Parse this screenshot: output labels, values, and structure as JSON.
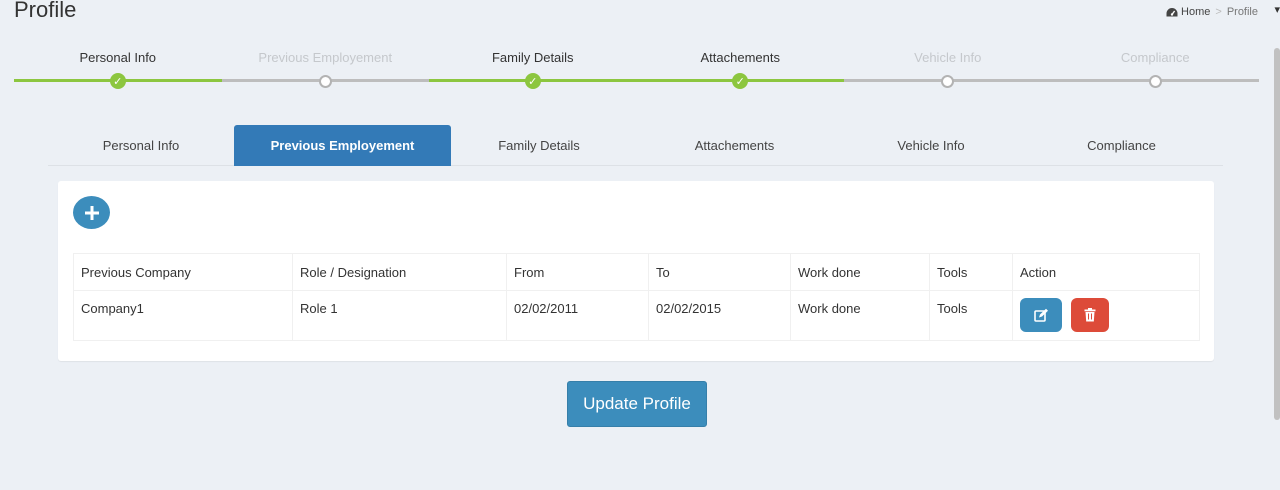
{
  "header": {
    "title": "Profile",
    "breadcrumb": {
      "home_icon": "dashboard-icon",
      "home": "Home",
      "current": "Profile"
    }
  },
  "progress": {
    "done_color": "#8cc63f",
    "steps": [
      {
        "label": "Personal Info",
        "state": "done"
      },
      {
        "label": "Previous Employement",
        "state": "pending"
      },
      {
        "label": "Family Details",
        "state": "done"
      },
      {
        "label": "Attachements",
        "state": "done"
      },
      {
        "label": "Vehicle Info",
        "state": "pending"
      },
      {
        "label": "Compliance",
        "state": "pending"
      }
    ]
  },
  "tabs": {
    "active": 1,
    "items": [
      {
        "label": "Personal Info"
      },
      {
        "label": "Previous Employement"
      },
      {
        "label": "Family Details"
      },
      {
        "label": "Attachements"
      },
      {
        "label": "Vehicle Info"
      },
      {
        "label": "Compliance"
      }
    ]
  },
  "panel": {
    "add_icon": "plus-icon",
    "table": {
      "columns": [
        "Previous Company",
        "Role / Designation",
        "From",
        "To",
        "Work done",
        "Tools",
        "Action"
      ],
      "rows": [
        {
          "company": "Company1",
          "role": "Role 1",
          "from": "02/02/2011",
          "to": "02/02/2015",
          "work_done": "Work done",
          "tools": "Tools"
        }
      ]
    },
    "edit_icon": "edit-icon",
    "delete_icon": "trash-icon"
  },
  "footer": {
    "update_label": "Update Profile"
  },
  "colors": {
    "primary": "#3c8dbc",
    "active_tab": "#337ab7",
    "danger": "#dd4b39",
    "background": "#ecf0f5"
  }
}
